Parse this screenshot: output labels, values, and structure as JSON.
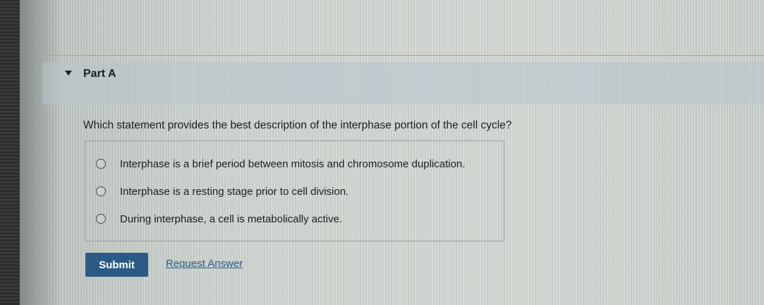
{
  "part": {
    "title": "Part A",
    "collapse_icon": "caret-down-icon"
  },
  "question": {
    "text": "Which statement provides the best description of the interphase portion of the cell cycle?"
  },
  "options": [
    {
      "label": "Interphase is a brief period between mitosis and chromosome duplication.",
      "selected": false
    },
    {
      "label": "Interphase is a resting stage prior to cell division.",
      "selected": false
    },
    {
      "label": "During interphase, a cell is metabolically active.",
      "selected": false
    }
  ],
  "actions": {
    "submit_label": "Submit",
    "request_answer_label": "Request Answer"
  },
  "colors": {
    "submit_button": "#2a5a86",
    "link": "#2c5d88",
    "header_band": "#b7c4ce"
  }
}
